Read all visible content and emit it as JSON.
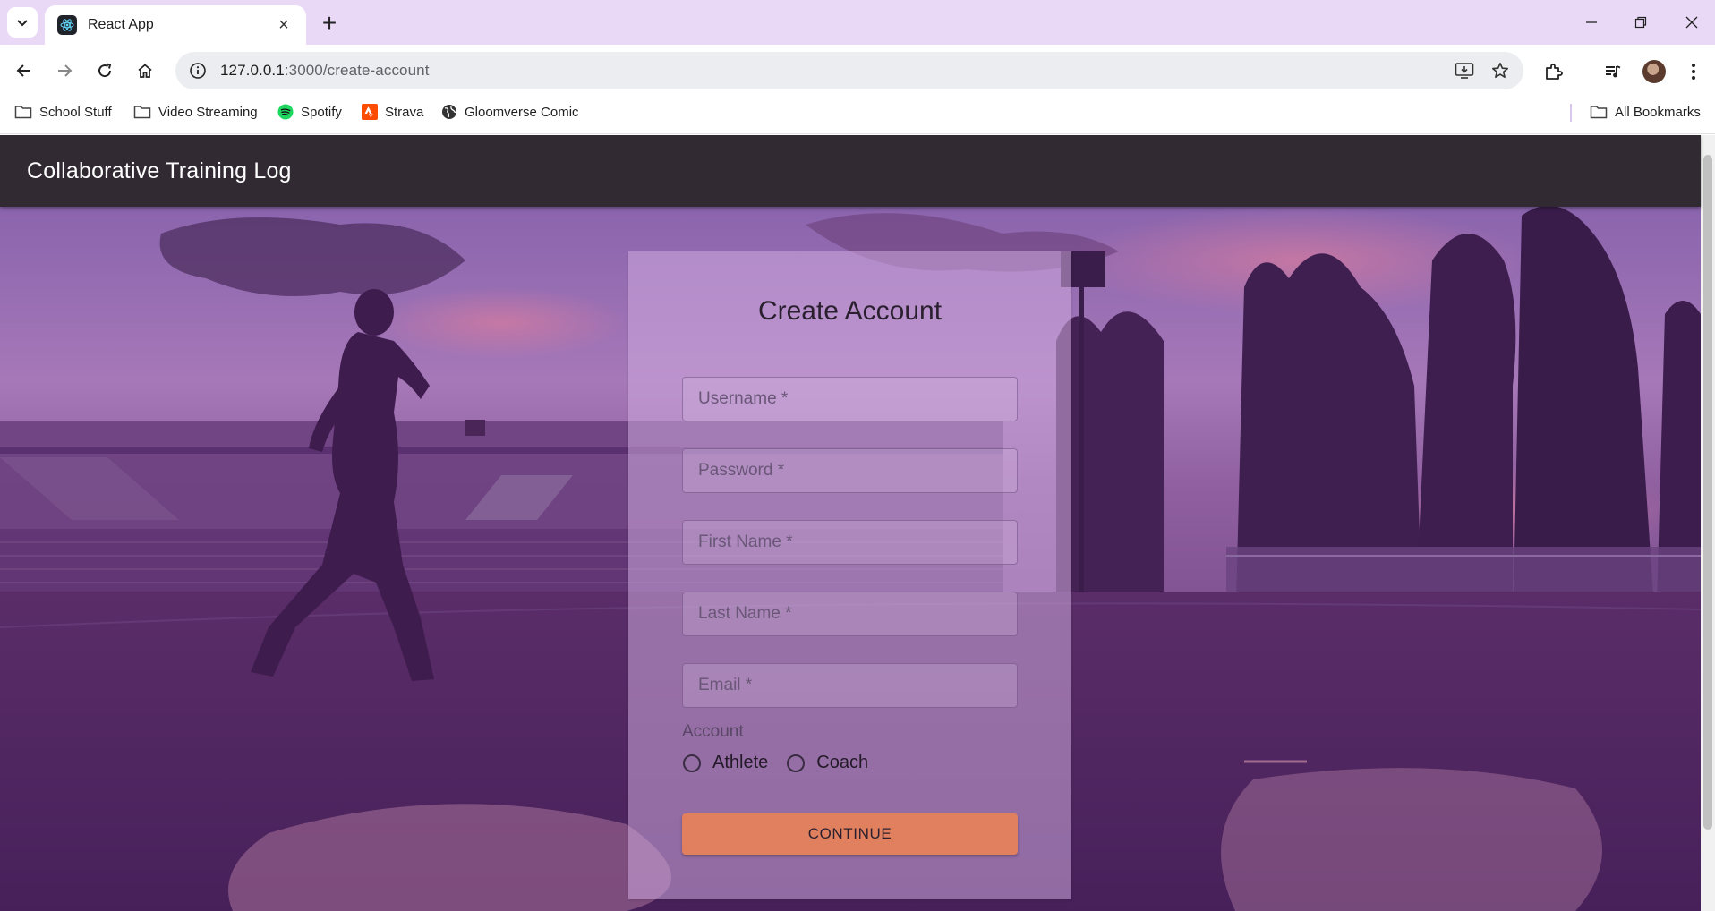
{
  "browser": {
    "tab": {
      "title": "React App"
    },
    "url": {
      "host": "127.0.0.1",
      "path": ":3000/create-account"
    },
    "bookmarks": [
      {
        "label": "School Stuff",
        "icon": "folder-icon"
      },
      {
        "label": "Video Streaming",
        "icon": "folder-icon"
      },
      {
        "label": "Spotify",
        "icon": "spotify-icon"
      },
      {
        "label": "Strava",
        "icon": "strava-icon"
      },
      {
        "label": "Gloomverse Comic",
        "icon": "globe-icon"
      }
    ],
    "all_bookmarks": "All Bookmarks"
  },
  "app": {
    "title": "Collaborative Training Log"
  },
  "form": {
    "title": "Create Account",
    "fields": [
      {
        "placeholder": "Username *",
        "value": ""
      },
      {
        "placeholder": "Password *",
        "value": ""
      },
      {
        "placeholder": "First Name *",
        "value": ""
      },
      {
        "placeholder": "Last Name *",
        "value": ""
      },
      {
        "placeholder": "Email *",
        "value": ""
      }
    ],
    "account_label": "Account",
    "account_options": [
      "Athlete",
      "Coach"
    ],
    "continue_label": "CONTINUE"
  },
  "colors": {
    "appbar": "#312a33",
    "button": "#e0805e",
    "tabstrip": "#e9d9f7"
  }
}
